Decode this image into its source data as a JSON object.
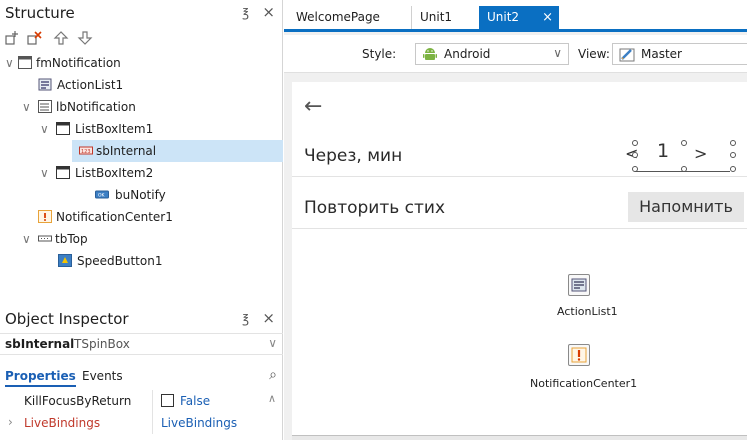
{
  "structure": {
    "title": "Structure",
    "pin_glyph": "℥",
    "close_glyph": "×",
    "toolbar": [
      "add-node-icon",
      "delete-node-icon",
      "move-up-icon",
      "move-down-icon"
    ],
    "tree": [
      {
        "label": "fmNotification",
        "icon": "form-icon"
      },
      {
        "label": "ActionList1",
        "icon": "actionlist-icon"
      },
      {
        "label": "lbNotification",
        "icon": "listbox-icon"
      },
      {
        "label": "ListBoxItem1",
        "icon": "listboxitem-icon"
      },
      {
        "label": "sbInternal",
        "icon": "spinbox-icon"
      },
      {
        "label": "ListBoxItem2",
        "icon": "listboxitem-icon"
      },
      {
        "label": "buNotify",
        "icon": "button-icon"
      },
      {
        "label": "NotificationCenter1",
        "icon": "notification-icon"
      },
      {
        "label": "tbTop",
        "icon": "toolbar-icon"
      },
      {
        "label": "SpeedButton1",
        "icon": "speedbutton-icon"
      }
    ]
  },
  "object_inspector": {
    "title": "Object Inspector",
    "selected_name": "sbInternal",
    "selected_type": "TSpinBox",
    "tabs": [
      "Properties",
      "Events"
    ],
    "properties": [
      {
        "name": "KillFocusByReturn",
        "value": "False"
      },
      {
        "name": "LiveBindings",
        "value": "LiveBindings"
      }
    ]
  },
  "doc_tabs": [
    "WelcomePage",
    "Unit1",
    "Unit2"
  ],
  "view_bar": {
    "style_label": "Style:",
    "style_value": "Android",
    "view_label": "View:",
    "view_value": "Master"
  },
  "form": {
    "back_glyph": "←",
    "row1_text": "Через, мин",
    "spin_left": "<",
    "spin_value": "1",
    "spin_right": ">",
    "row2_text": "Повторить стих",
    "notify_button": "Напомнить",
    "components": [
      "ActionList1",
      "NotificationCenter1"
    ]
  },
  "colors": {
    "accent": "#0a6fc2",
    "selection": "#cce4f7",
    "android_green": "#7cb342",
    "notification_orange": "#e8a33a",
    "live_bindings_red": "#c0392b",
    "property_value_blue": "#1a5fb4"
  }
}
